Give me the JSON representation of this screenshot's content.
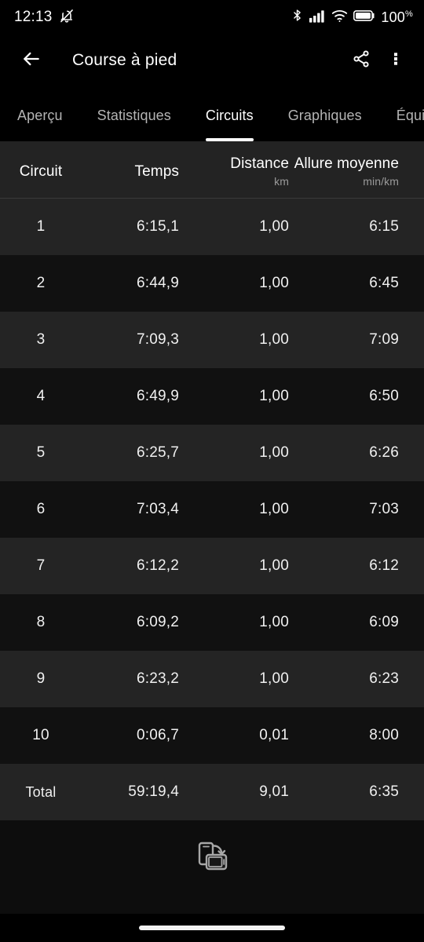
{
  "status_bar": {
    "time": "12:13",
    "silent_icon": "bell-muted-icon",
    "bluetooth_icon": "bluetooth-icon",
    "signal_icon": "cellular-signal-icon",
    "wifi_icon": "wifi-icon",
    "battery_icon": "battery-full-icon",
    "battery_level": "100",
    "battery_unit": "%"
  },
  "app_bar": {
    "back_icon": "back-arrow-icon",
    "title": "Course à pied",
    "share_icon": "share-icon",
    "overflow_icon": "more-vertical-icon"
  },
  "tabs": {
    "active_index": 2,
    "items": [
      {
        "label": "Aperçu"
      },
      {
        "label": "Statistiques"
      },
      {
        "label": "Circuits"
      },
      {
        "label": "Graphiques"
      },
      {
        "label": "Équipeme"
      }
    ]
  },
  "table": {
    "headers": [
      {
        "label": "Circuit",
        "sub": ""
      },
      {
        "label": "Temps",
        "sub": ""
      },
      {
        "label": "Distance",
        "sub": "km"
      },
      {
        "label": "Allure moyenne",
        "sub": "min/km"
      }
    ],
    "rows": [
      {
        "lap": "1",
        "time": "6:15,1",
        "distance": "1,00",
        "pace": "6:15"
      },
      {
        "lap": "2",
        "time": "6:44,9",
        "distance": "1,00",
        "pace": "6:45"
      },
      {
        "lap": "3",
        "time": "7:09,3",
        "distance": "1,00",
        "pace": "7:09"
      },
      {
        "lap": "4",
        "time": "6:49,9",
        "distance": "1,00",
        "pace": "6:50"
      },
      {
        "lap": "5",
        "time": "6:25,7",
        "distance": "1,00",
        "pace": "6:26"
      },
      {
        "lap": "6",
        "time": "7:03,4",
        "distance": "1,00",
        "pace": "7:03"
      },
      {
        "lap": "7",
        "time": "6:12,2",
        "distance": "1,00",
        "pace": "6:12"
      },
      {
        "lap": "8",
        "time": "6:09,2",
        "distance": "1,00",
        "pace": "6:09"
      },
      {
        "lap": "9",
        "time": "6:23,2",
        "distance": "1,00",
        "pace": "6:23"
      },
      {
        "lap": "10",
        "time": "0:06,7",
        "distance": "0,01",
        "pace": "8:00"
      }
    ],
    "total": {
      "lap": "Total",
      "time": "59:19,4",
      "distance": "9,01",
      "pace": "6:35"
    }
  },
  "rotate_hint": {
    "icon": "screen-rotation-icon"
  },
  "nav_bar": {
    "handle": "gesture-home-handle"
  },
  "colors": {
    "background": "#0d0d0d",
    "bar_background": "#000000",
    "row_odd": "#242424",
    "row_even": "#111111",
    "header_row": "#232323",
    "accent": "#ffffff",
    "muted_text": "#9a9a9a"
  }
}
